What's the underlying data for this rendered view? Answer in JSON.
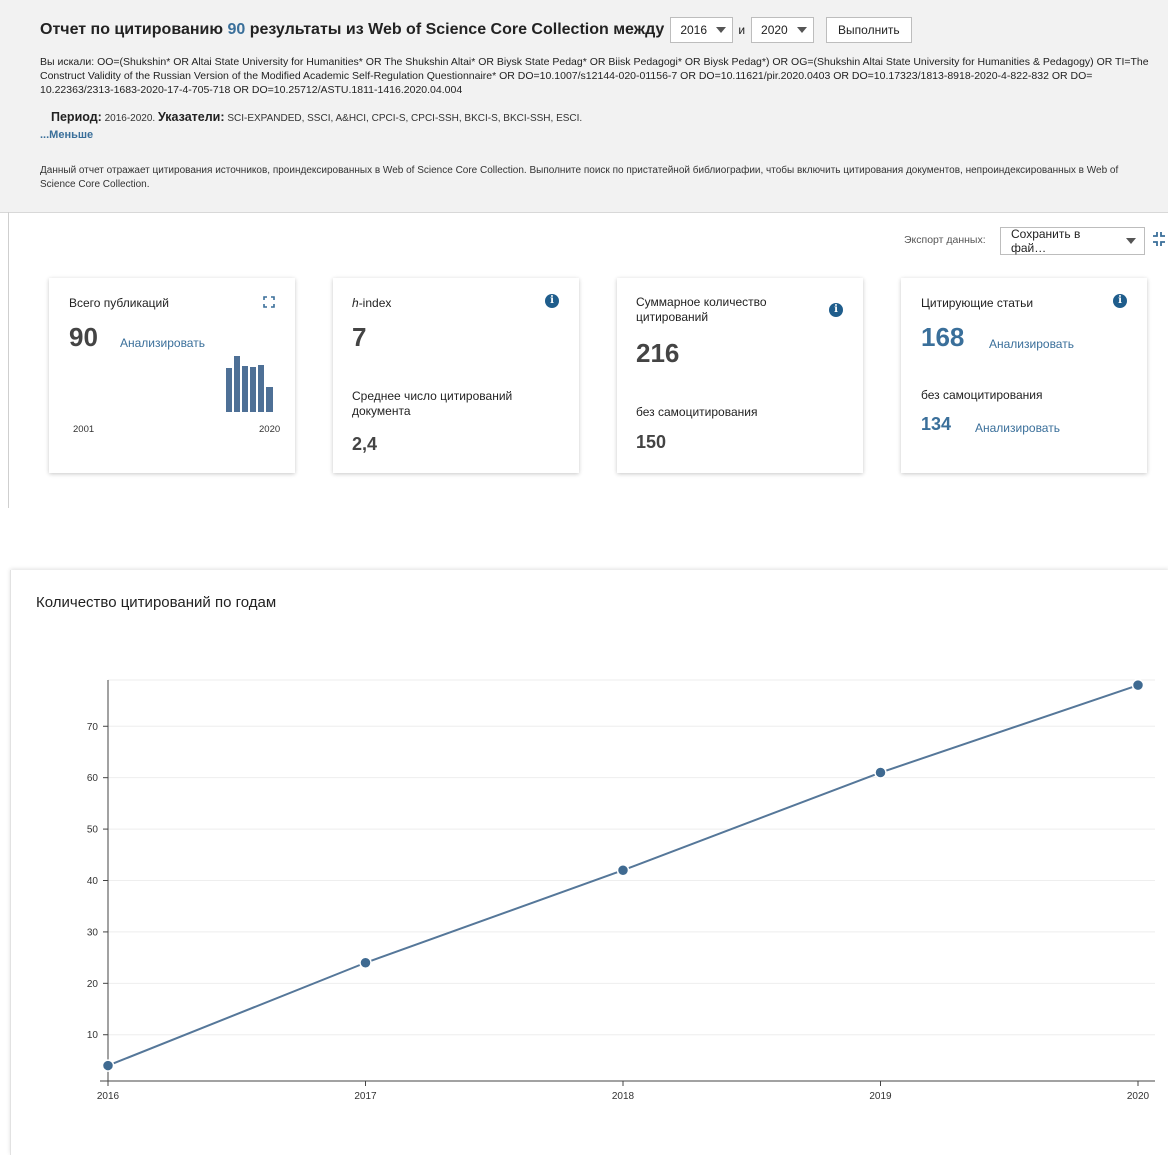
{
  "header": {
    "title_prefix": "Отчет по цитированию",
    "results_count": "90",
    "title_suffix": "результаты из Web of Science Core Collection между",
    "year_from": "2016",
    "and_label": "и",
    "year_to": "2020",
    "run_button": "Выполнить"
  },
  "query": {
    "text": "Вы искали: OO=(Shukshin* OR Altai State University for Humanities* OR The Shukshin Altai* OR Biysk State Pedag* OR Biisk Pedagogi* OR Biysk Pedag*) OR OG=(Shukshin Altai State University for Humanities & Pedagogy) OR TI=The Construct Validity of the Russian Version of the Modified Academic Self-Regulation Questionnaire* OR DO=10.1007/s12144-020-01156-7 OR DO=10.11621/pir.2020.0403 OR DO=10.17323/1813-8918-2020-4-822-832 OR DO= 10.22363/2313-1683-2020-17-4-705-718 OR DO=10.25712/ASTU.1811-1416.2020.04.004",
    "period_label": "Период:",
    "period_value": "2016-2020.",
    "indexes_label": "Указатели:",
    "indexes_value": "SCI-EXPANDED, SSCI, A&HCI, CPCI-S, CPCI-SSH, BKCI-S, BKCI-SSH, ESCI.",
    "less_link": "...Меньше",
    "note": "Данный отчет отражает цитирования источников, проиндексированных в Web of Science Core Collection. Выполните поиск по пристатейной библиографии, чтобы включить цитирования документов, непроиндексированных в Web of Science Core Collection."
  },
  "export": {
    "label": "Экспорт данных:",
    "selected": "Сохранить в фай…"
  },
  "cards": {
    "publications": {
      "label": "Всего публикаций",
      "value": "90",
      "link": "Анализировать",
      "year_start": "2001",
      "year_end": "2020"
    },
    "hindex": {
      "label_italic": "h",
      "label_rest": "-index",
      "value": "7",
      "avg_label": "Среднее число цитирований документа",
      "avg_value": "2,4"
    },
    "citations": {
      "label": "Суммарное количество цитирований",
      "value": "216",
      "self_label": "без самоцитирования",
      "self_value": "150"
    },
    "citing": {
      "label": "Цитирующие статьи",
      "value": "168",
      "link": "Анализировать",
      "self_label": "без самоцитирования",
      "self_value": "134",
      "self_link": "Анализировать"
    }
  },
  "colors": {
    "accent": "#3a6f9a",
    "line": "#557799",
    "info": "#1f5d8c"
  },
  "chart_data": {
    "type": "line",
    "title": "Количество цитирований по годам",
    "x": [
      "2016",
      "2017",
      "2018",
      "2019",
      "2020"
    ],
    "values": [
      4,
      24,
      42,
      61,
      78
    ],
    "yticks": [
      10,
      20,
      30,
      40,
      50,
      60,
      70
    ],
    "ylim": [
      1,
      79
    ],
    "grid": true
  }
}
